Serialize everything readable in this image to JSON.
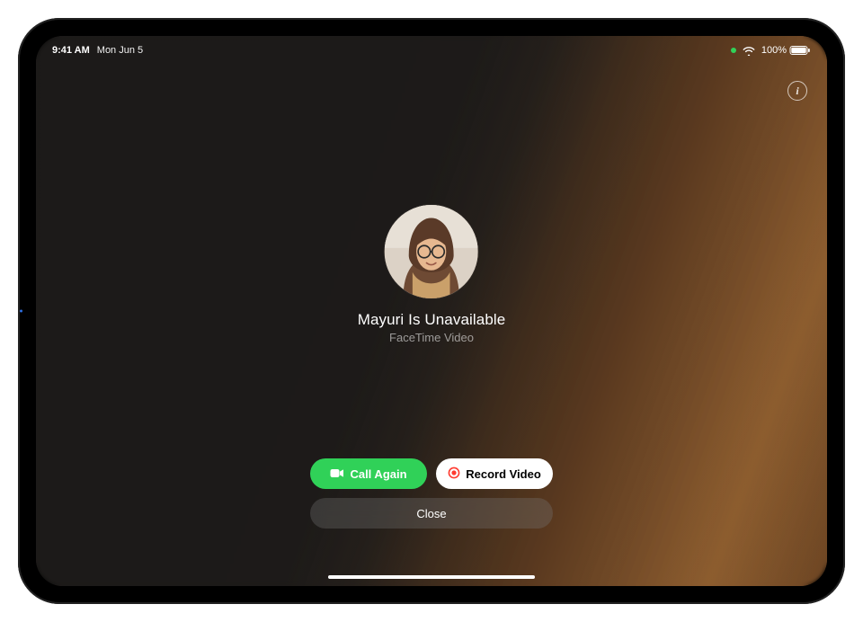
{
  "statusBar": {
    "time": "9:41 AM",
    "date": "Mon Jun 5",
    "batteryPercent": "100%"
  },
  "call": {
    "statusTitle": "Mayuri Is Unavailable",
    "statusSubtitle": "FaceTime Video"
  },
  "buttons": {
    "callAgain": "Call Again",
    "recordVideo": "Record Video",
    "close": "Close"
  },
  "colors": {
    "accentGreen": "#30d158",
    "recordRed": "#ff3b30"
  }
}
